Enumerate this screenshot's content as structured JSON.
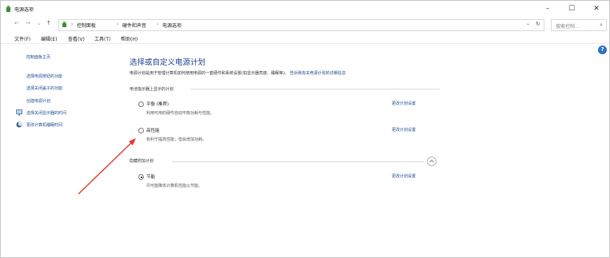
{
  "window": {
    "title": "电源选项",
    "controls": {
      "minimize": "–",
      "maximize": "☐",
      "close": "✕"
    }
  },
  "address_bar": {
    "nav": {
      "back": "←",
      "forward": "→",
      "dropdown": "⌄",
      "up": "↑"
    },
    "breadcrumb": [
      "控制面板",
      "硬件和声音",
      "电源选项"
    ],
    "separator": "›",
    "dropdown": "⌄",
    "refresh": "↻",
    "search_placeholder": "搜索控制...",
    "search_icon": "⌕"
  },
  "menu": [
    "文件(F)",
    "编辑(E)",
    "查看(V)",
    "工具(T)",
    "帮助(H)"
  ],
  "help": {
    "label": "?"
  },
  "sidebar": {
    "items": [
      {
        "label": "控制面板主页",
        "icon": null
      },
      {
        "label": "选择电源按钮的功能",
        "icon": null
      },
      {
        "label": "选择关闭盖子的功能",
        "icon": null
      },
      {
        "label": "创建电源计划",
        "icon": null
      },
      {
        "label": "选择关闭显示器的时间",
        "icon": "monitor-icon"
      },
      {
        "label": "更改计算机睡眠时间",
        "icon": "moon-icon"
      }
    ]
  },
  "main": {
    "title": "选择或自定义电源计划",
    "description": "电源计划是用于管理计算机如何使用电源的一套硬件和系统设置(如显示器亮度、睡眠等)。",
    "description_link": "告诉我有关电源计划的详细信息",
    "preferred_section": "电池指示器上显示的计划",
    "hidden_section": "隐藏附加计划",
    "plans": [
      {
        "name": "平衡 (推荐)",
        "desc": "利用可用的硬件自动平衡功耗与性能。",
        "selected": false,
        "change_label": "更改计划设置"
      },
      {
        "name": "高性能",
        "desc": "有利于提高性能，但会增加功耗。",
        "selected": false,
        "change_label": "更改计划设置"
      },
      {
        "name": "节能",
        "desc": "尽可能降低计算机性能以节能。",
        "selected": true,
        "change_label": "更改计划设置"
      }
    ]
  },
  "colors": {
    "link": "#1c4a95",
    "title": "#1a3f8f",
    "annotation_arrow": "#e33b2e",
    "help": "#2e6fc7"
  }
}
